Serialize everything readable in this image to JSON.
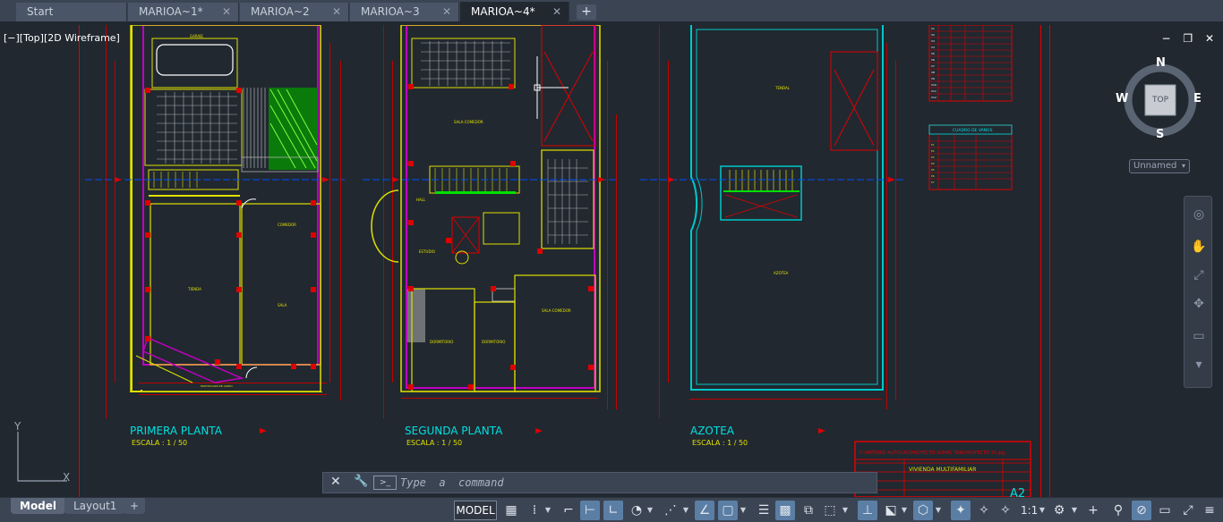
{
  "tabs": [
    {
      "label": "Start",
      "closable": false
    },
    {
      "label": "MARIOA~1*",
      "closable": true
    },
    {
      "label": "MARIOA~2",
      "closable": true
    },
    {
      "label": "MARIOA~3",
      "closable": true
    },
    {
      "label": "MARIOA~4*",
      "closable": true,
      "active": true
    }
  ],
  "tab_add": "+",
  "viewport": {
    "label": "[−][Top][2D Wireframe]",
    "minimize": "−",
    "restore": "❐",
    "close": "✕"
  },
  "viewcube": {
    "north": "N",
    "south": "S",
    "east": "E",
    "west": "W",
    "face": "TOP",
    "ucs_menu": "Unnamed"
  },
  "drawing": {
    "plans": [
      {
        "title": "PRIMERA PLANTA",
        "scale": "ESCALA :  1 / 50"
      },
      {
        "title": "SEGUNDA  PLANTA",
        "scale": "ESCALA :  1 / 50"
      },
      {
        "title": "AZOTEA",
        "scale": "ESCALA :  1 / 50"
      }
    ],
    "table_title": "CUADRO DE VANOS",
    "title_block": {
      "path": "C:\\ARTONIO AUTOCAD\\PROYECTO SUMAC TAKI\\PROYECTO 33.jpg",
      "project": "VIVIENDA MULTIFAMILIAR",
      "sheet": "A2"
    },
    "ucs": {
      "x": "X",
      "y": "Y"
    }
  },
  "command": {
    "placeholder": "Type  a  command"
  },
  "layout_tabs": [
    {
      "label": "Model",
      "active": true
    },
    {
      "label": "Layout1",
      "active": false
    }
  ],
  "layout_add": "+",
  "status": {
    "model": "MODEL",
    "scale": "1:1"
  },
  "colors": {
    "background": "#212830",
    "wall": "#e0e000",
    "column": "#e00000",
    "dimension": "#c00000",
    "partition": "#c000c0",
    "roof_outline": "#00c8c8",
    "text_cyan": "#00e0e0",
    "hatch": "#00ff00",
    "tab_bar": "#3b4453"
  }
}
